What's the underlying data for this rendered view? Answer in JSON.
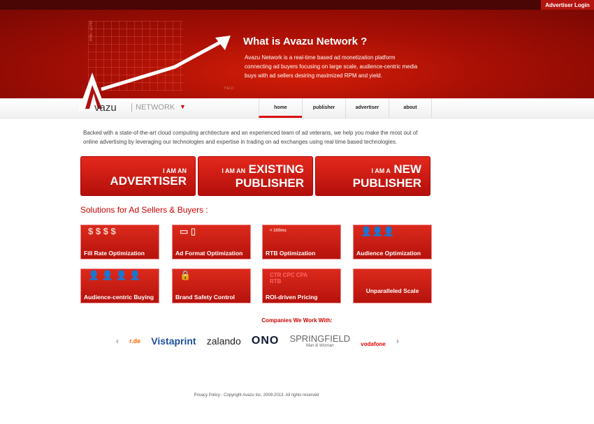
{
  "header": {
    "login": "Advertiser Login"
  },
  "hero": {
    "title": "What is Avazu Network ?",
    "text": "Avazu Network is a real-time based ad monetization platform connecting ad buyers focusing on large scale, audience-centric media buys with ad sellers desiring maximized RPM and yield.",
    "y_axis": "RPM / eCPM",
    "x_axis": "YIELD"
  },
  "logo": {
    "name": "vazu",
    "sub": "NETWORK"
  },
  "nav": [
    "home",
    "publisher",
    "advertiser",
    "about"
  ],
  "intro": "Backed with a state-of-the-art cloud computing architecture and an experienced team of ad veterans, we help you make the most out of online advertising by leveraging our technologies and expertise in trading on ad exchanges using real time based technologies.",
  "cta": [
    {
      "small": "I AM AN",
      "large": "ADVERTISER"
    },
    {
      "small": "I AM AN",
      "large": "EXISTING",
      "large2": "PUBLISHER"
    },
    {
      "small": "I AM A",
      "large": "NEW",
      "large2": "PUBLISHER"
    }
  ],
  "solutions_title": "Solutions for Ad Sellers & Buyers :",
  "solutions": [
    "Fill Rate Optimization",
    "Ad Format Optimization",
    "RTB Optimization",
    "Audience Optimization",
    "Audience-centric Buying",
    "Brand Safety Control",
    "ROI-driven Pricing",
    "Unparalleled Scale"
  ],
  "rtb_label": "< 100ms",
  "pricing_labels": "CTR CPC CPA RTB",
  "companies_title": "Companies We Work With:",
  "companies": [
    "r.de",
    "Vistaprint",
    "zalando",
    "ONO",
    "SPRINGFIELD",
    "Man & Woman",
    "vodafone"
  ],
  "footer": "Privacy Policy - Copyright Avazu Inc. 2009-2013. All rights reserved"
}
